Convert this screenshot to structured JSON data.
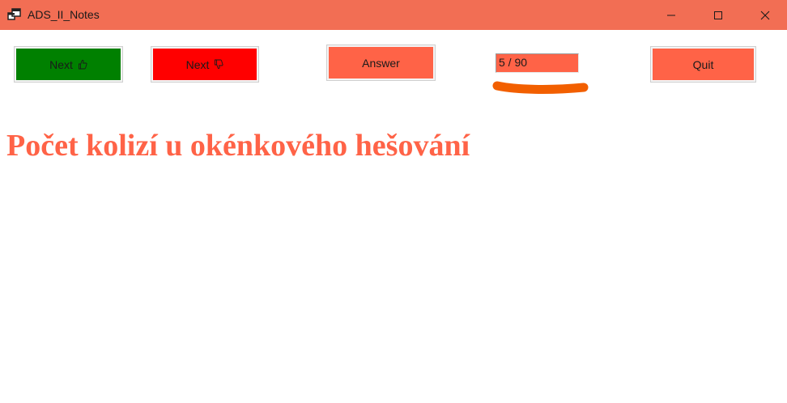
{
  "window": {
    "title": "ADS_II_Notes",
    "app_icon": "app-window-icon",
    "controls": [
      "minimize-icon",
      "maximize-icon",
      "close-icon"
    ],
    "titlebar_color": "#f26e54"
  },
  "toolbar": {
    "next_correct_label": "Next",
    "next_correct_icon": "thumbs-up-icon",
    "next_correct_color": "#008000",
    "next_wrong_label": "Next",
    "next_wrong_icon": "thumbs-down-icon",
    "next_wrong_color": "#ff0000",
    "answer_label": "Answer",
    "counter_value": "5 / 90",
    "quit_label": "Quit",
    "accent_color": "#ff6347"
  },
  "annotation": {
    "underline_color": "#f25f00"
  },
  "main": {
    "question": "Počet kolizí u okénkového hešování"
  }
}
